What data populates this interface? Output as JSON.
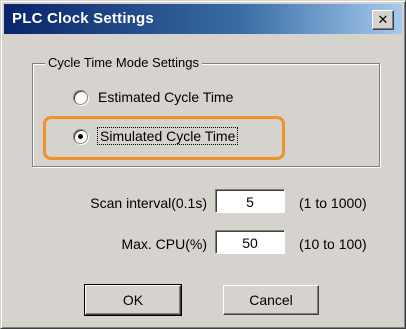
{
  "window": {
    "title": "PLC Clock Settings",
    "close_symbol": "✕"
  },
  "cycle_mode_group": {
    "legend": "Cycle Time Mode Settings",
    "options": [
      {
        "label": "Estimated Cycle Time",
        "selected": false
      },
      {
        "label": "Simulated Cycle Time",
        "selected": true
      }
    ]
  },
  "fields": {
    "scan_interval": {
      "label": "Scan interval(0.1s)",
      "value": "5",
      "range": "(1 to 1000)"
    },
    "max_cpu": {
      "label": "Max. CPU(%)",
      "value": "50",
      "range": "(10 to 100)"
    }
  },
  "buttons": {
    "ok": "OK",
    "cancel": "Cancel"
  },
  "colors": {
    "highlight": "#f0902a",
    "title_bar": "#0a246a",
    "dialog_face": "#d6d3ce"
  }
}
